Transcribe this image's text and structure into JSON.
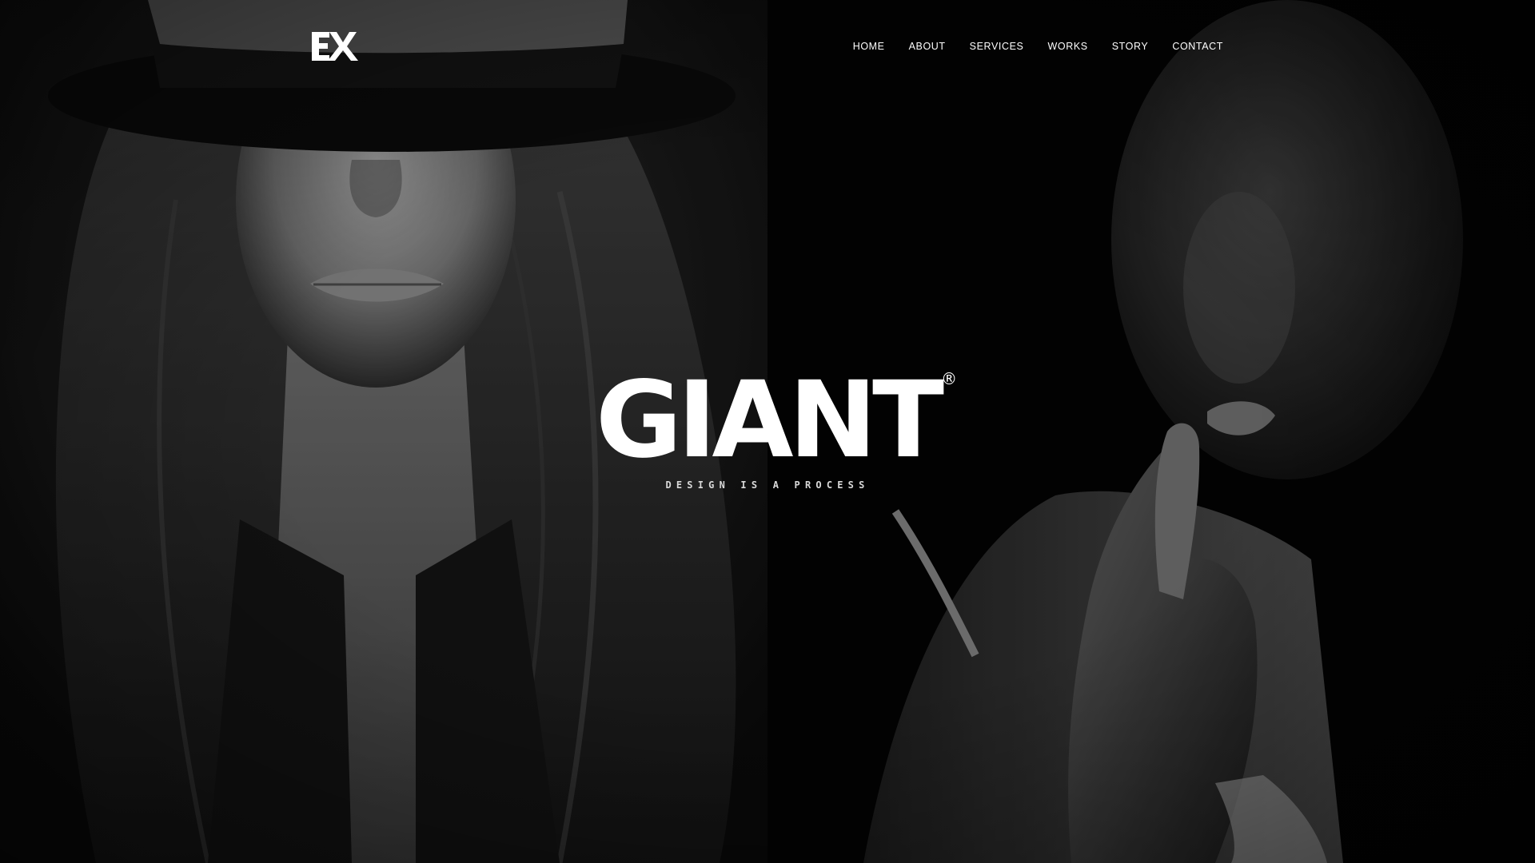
{
  "logo": {
    "text": "EX",
    "icon": "ex-monogram-logo"
  },
  "nav": {
    "items": [
      {
        "label": "HOME"
      },
      {
        "label": "ABOUT"
      },
      {
        "label": "SERVICES"
      },
      {
        "label": "WORKS"
      },
      {
        "label": "STORY"
      },
      {
        "label": "CONTACT"
      }
    ]
  },
  "hero": {
    "title": "GIANT",
    "registered_mark": "®",
    "tagline": "DESIGN IS A PROCESS"
  },
  "colors": {
    "background": "#050505",
    "text": "#ffffff",
    "tagline": "#d9d9d9"
  }
}
